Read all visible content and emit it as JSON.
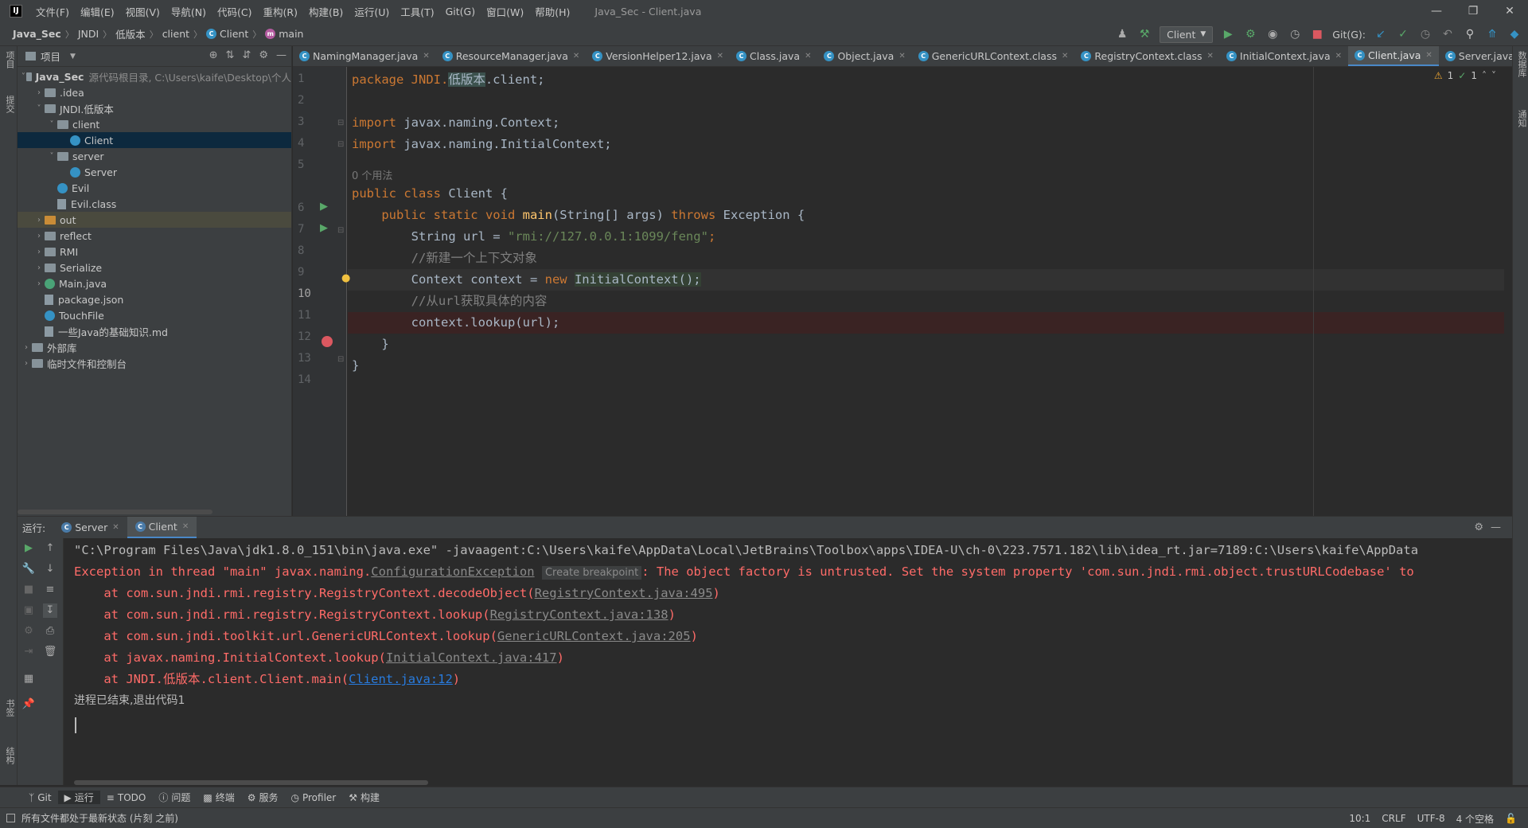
{
  "menu": {
    "logo": "IJ",
    "items": [
      "文件(F)",
      "编辑(E)",
      "视图(V)",
      "导航(N)",
      "代码(C)",
      "重构(R)",
      "构建(B)",
      "运行(U)",
      "工具(T)",
      "Git(G)",
      "窗口(W)",
      "帮助(H)"
    ],
    "window_title": "Java_Sec - Client.java"
  },
  "breadcrumb": [
    "Java_Sec",
    "JNDI",
    "低版本",
    "client",
    "Client",
    "main"
  ],
  "toolbar": {
    "run_config": "Client",
    "git_label": "Git(G):"
  },
  "stripe": {
    "left_top": "项目",
    "left_mid": "提交",
    "left_bottom1": "书签",
    "left_bottom2": "结构",
    "right_top": "数据库",
    "right_mid": "通知"
  },
  "project": {
    "title": "项目",
    "tree": [
      {
        "label": "Java_Sec",
        "extra": "源代码根目录, C:\\Users\\kaife\\Desktop\\个人",
        "indent": 0,
        "kind": "folder",
        "expanded": true
      },
      {
        "label": ".idea",
        "indent": 1,
        "kind": "folder",
        "expanded": false
      },
      {
        "label": "JNDI.低版本",
        "indent": 1,
        "kind": "folder",
        "expanded": true
      },
      {
        "label": "client",
        "indent": 2,
        "kind": "folder",
        "expanded": true
      },
      {
        "label": "Client",
        "indent": 3,
        "kind": "class",
        "selected": true
      },
      {
        "label": "server",
        "indent": 2,
        "kind": "folder",
        "expanded": true
      },
      {
        "label": "Server",
        "indent": 3,
        "kind": "class"
      },
      {
        "label": "Evil",
        "indent": 2,
        "kind": "class"
      },
      {
        "label": "Evil.class",
        "indent": 2,
        "kind": "doc"
      },
      {
        "label": "out",
        "indent": 1,
        "kind": "folder-orange",
        "expanded": false,
        "highlight": true
      },
      {
        "label": "reflect",
        "indent": 1,
        "kind": "folder",
        "expanded": false
      },
      {
        "label": "RMI",
        "indent": 1,
        "kind": "folder",
        "expanded": false
      },
      {
        "label": "Serialize",
        "indent": 1,
        "kind": "folder",
        "expanded": false
      },
      {
        "label": "Main.java",
        "indent": 1,
        "kind": "class-g",
        "expanded": false
      },
      {
        "label": "package.json",
        "indent": 1,
        "kind": "doc"
      },
      {
        "label": "TouchFile",
        "indent": 1,
        "kind": "class"
      },
      {
        "label": "一些Java的基础知识.md",
        "indent": 1,
        "kind": "doc"
      },
      {
        "label": "外部库",
        "indent": 0,
        "kind": "lib",
        "expanded": false
      },
      {
        "label": "临时文件和控制台",
        "indent": 0,
        "kind": "scratch",
        "expanded": false
      }
    ]
  },
  "tabs": [
    {
      "label": "NamingManager.java",
      "active": false
    },
    {
      "label": "ResourceManager.java",
      "active": false
    },
    {
      "label": "VersionHelper12.java",
      "active": false
    },
    {
      "label": "Class.java",
      "active": false
    },
    {
      "label": "Object.java",
      "active": false
    },
    {
      "label": "GenericURLContext.class",
      "active": false
    },
    {
      "label": "RegistryContext.class",
      "active": false
    },
    {
      "label": "InitialContext.java",
      "active": false
    },
    {
      "label": "Client.java",
      "active": true
    },
    {
      "label": "Server.java",
      "active": false
    }
  ],
  "editor": {
    "inspection_warnings": "1",
    "inspection_ok": "1",
    "usage_hint": "0 个用法",
    "lines": {
      "l1": [
        "package JNDI.",
        "低版本",
        ".client;"
      ],
      "l3": [
        "import ",
        "javax.naming.Context;"
      ],
      "l4": [
        "import ",
        "javax.naming.InitialContext;"
      ],
      "l6": [
        "public class ",
        "Client {"
      ],
      "l7": [
        "    public static void ",
        "main",
        "(String[] args) ",
        "throws ",
        "Exception {"
      ],
      "l8": [
        "        String url = ",
        "\"rmi://127.0.0.1:1099/feng\"",
        ";"
      ],
      "l9": "        //新建一个上下文对象",
      "l10": [
        "        Context context = ",
        "new ",
        "InitialContext();"
      ],
      "l11": "        //从url获取具体的内容",
      "l12": "        context.lookup(url);",
      "l13": "    }",
      "l14": "}"
    }
  },
  "run": {
    "label": "运行:",
    "tabs": [
      "Server",
      "Client"
    ],
    "console": {
      "cmd": "\"C:\\Program Files\\Java\\jdk1.8.0_151\\bin\\java.exe\" -javaagent:C:\\Users\\kaife\\AppData\\Local\\JetBrains\\Toolbox\\apps\\IDEA-U\\ch-0\\223.7571.182\\lib\\idea_rt.jar=7189:C:\\Users\\kaife\\AppData",
      "exc_prefix": "Exception in thread \"main\" javax.naming.",
      "exc_class": "ConfigurationException",
      "create_bp": "Create breakpoint",
      "exc_msg": ": The object factory is untrusted. Set the system property 'com.sun.jndi.rmi.object.trustURLCodebase' to",
      "frames": [
        {
          "at": "    at com.sun.jndi.rmi.registry.RegistryContext.decodeObject(",
          "src": "RegistryContext.java:495",
          "end": ")",
          "user": false
        },
        {
          "at": "    at com.sun.jndi.rmi.registry.RegistryContext.lookup(",
          "src": "RegistryContext.java:138",
          "end": ")",
          "user": false
        },
        {
          "at": "    at com.sun.jndi.toolkit.url.GenericURLContext.lookup(",
          "src": "GenericURLContext.java:205",
          "end": ")",
          "user": false
        },
        {
          "at": "    at javax.naming.InitialContext.lookup(",
          "src": "InitialContext.java:417",
          "end": ")",
          "user": false
        },
        {
          "at": "    at JNDI.低版本.client.Client.main(",
          "src": "Client.java:12",
          "end": ")",
          "user": true
        }
      ],
      "exit": "进程已结束,退出代码1"
    }
  },
  "toolwindows": [
    "Git",
    "运行",
    "TODO",
    "问题",
    "终端",
    "服务",
    "Profiler",
    "构建"
  ],
  "status": {
    "text": "所有文件都处于最新状态 (片刻 之前)",
    "position": "10:1",
    "line_sep": "CRLF",
    "encoding": "UTF-8",
    "indent": "4 个空格"
  },
  "colors": {
    "accent": "#4a88c7",
    "error": "#ff6b68",
    "breakpoint": "#db5860",
    "run_green": "#59a869"
  }
}
